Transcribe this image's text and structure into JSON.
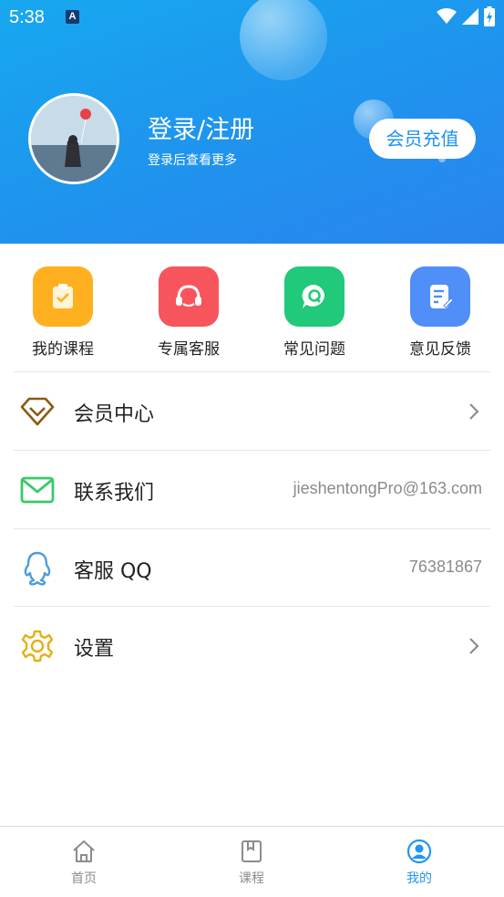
{
  "status_bar": {
    "time": "5:38",
    "notification_badge": "A"
  },
  "header": {
    "login_title": "登录/注册",
    "login_subtitle": "登录后查看更多",
    "vip_button": "会员充值"
  },
  "quick_actions": [
    {
      "label": "我的课程",
      "icon": "clipboard-check-icon",
      "color": "#ffb020"
    },
    {
      "label": "专属客服",
      "icon": "headset-icon",
      "color": "#f7555c"
    },
    {
      "label": "常见问题",
      "icon": "question-chat-icon",
      "color": "#21c97a"
    },
    {
      "label": "意见反馈",
      "icon": "edit-note-icon",
      "color": "#4f8ff7"
    }
  ],
  "menu": [
    {
      "label": "会员中心",
      "icon": "diamond-icon",
      "value": "",
      "has_chevron": true
    },
    {
      "label": "联系我们",
      "icon": "mail-icon",
      "value": "jieshentongPro@163.com",
      "has_chevron": false
    },
    {
      "label": "客服 QQ",
      "icon": "qq-icon",
      "value": "76381867",
      "has_chevron": false
    },
    {
      "label": "设置",
      "icon": "gear-icon",
      "value": "",
      "has_chevron": true
    }
  ],
  "tabbar": {
    "tabs": [
      {
        "label": "首页",
        "icon": "home-icon",
        "active": false
      },
      {
        "label": "课程",
        "icon": "book-icon",
        "active": false
      },
      {
        "label": "我的",
        "icon": "user-icon",
        "active": true
      }
    ]
  },
  "colors": {
    "header_gradient_start": "#17a8ef",
    "header_gradient_end": "#2a84ee",
    "accent": "#2196f3"
  }
}
